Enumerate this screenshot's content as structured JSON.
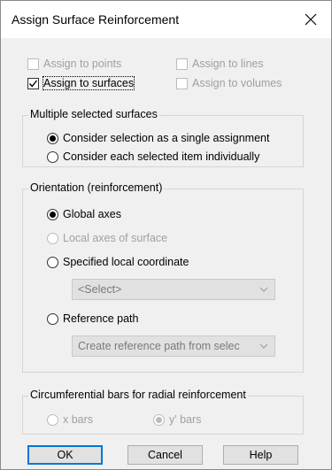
{
  "dialog": {
    "title": "Assign Surface Reinforcement"
  },
  "assign": {
    "points": {
      "label": "Assign to points",
      "checked": false,
      "enabled": false
    },
    "lines": {
      "label": "Assign to lines",
      "checked": false,
      "enabled": false
    },
    "surfaces": {
      "label": "Assign to surfaces",
      "checked": true,
      "enabled": true
    },
    "volumes": {
      "label": "Assign to volumes",
      "checked": false,
      "enabled": false
    }
  },
  "multiple": {
    "title": "Multiple selected surfaces",
    "opt_single": "Consider selection as a single assignment",
    "opt_individual": "Consider each selected item individually",
    "selected": "single"
  },
  "orientation": {
    "title": "Orientation (reinforcement)",
    "opt_global": "Global axes",
    "opt_local": "Local axes of surface",
    "opt_specified": "Specified local coordinate",
    "specified_select": "<Select>",
    "opt_reference": "Reference path",
    "reference_select": "Create reference path from selec",
    "selected": "global"
  },
  "circumferential": {
    "title": "Circumferential bars for radial reinforcement",
    "opt_x": "x bars",
    "opt_y": "y' bars",
    "selected": "y",
    "enabled": false
  },
  "buttons": {
    "ok": "OK",
    "cancel": "Cancel",
    "help": "Help"
  },
  "icons": {
    "close": "close-icon",
    "check": "checkmark-icon",
    "chevron": "chevron-down-icon"
  }
}
